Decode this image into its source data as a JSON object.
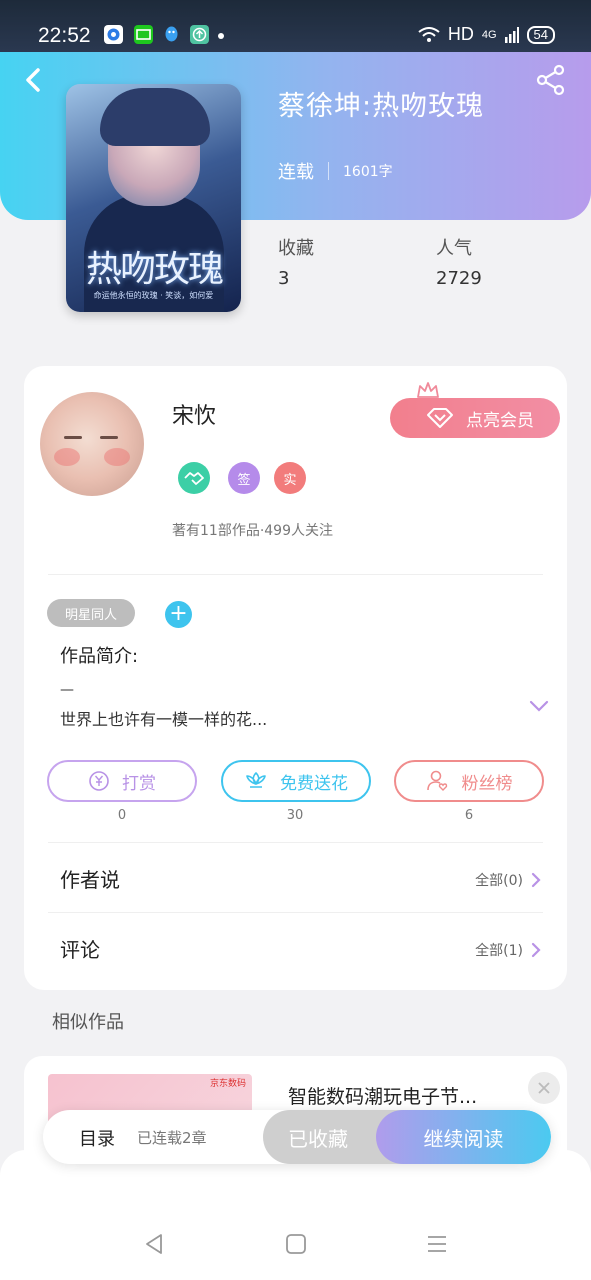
{
  "status_bar": {
    "time": "22:52",
    "network": "HD",
    "signal": "4G",
    "battery": "54"
  },
  "book": {
    "title": "蔡徐坤:热吻玫瑰",
    "status": "连载",
    "word_count": "1601字",
    "cover_title": "热吻玫瑰",
    "cover_subtitle": "命运他永恒的玫瑰 · 笑谈，如何爱",
    "stats": [
      {
        "label": "收藏",
        "value": "3"
      },
      {
        "label": "人气",
        "value": "2729"
      }
    ]
  },
  "author": {
    "name": "宋忺",
    "vip_button": "点亮会员",
    "badges": [
      {
        "label": "",
        "color": "#3ccfa6",
        "icon": "handshake-icon"
      },
      {
        "label": "签",
        "color": "#b58bea"
      },
      {
        "label": "实",
        "color": "#f27c7c"
      }
    ],
    "stats": "著有11部作品·499人关注"
  },
  "tags": {
    "pill": "明星同人",
    "add": "+"
  },
  "intro": {
    "title": "作品简介:",
    "dash": "—",
    "text": "世界上也许有一模一样的花..."
  },
  "actions": [
    {
      "label": "打赏",
      "count": "0",
      "color": "#b892e6",
      "icon": "yuan-icon"
    },
    {
      "label": "免费送花",
      "count": "30",
      "color": "#3ec4ee",
      "icon": "flower-icon"
    },
    {
      "label": "粉丝榜",
      "count": "6",
      "color": "#f08c8c",
      "icon": "fan-user-icon"
    }
  ],
  "sections": [
    {
      "title": "作者说",
      "more": "全部(0)"
    },
    {
      "title": "评论",
      "more": "全部(1)"
    }
  ],
  "similar": {
    "title": "相似作品",
    "items": [
      {
        "name": "智能数码潮玩电子节...",
        "thumb_label": "京东数码"
      }
    ]
  },
  "bottom_bar": {
    "toc_label": "目录",
    "toc_count": "已连载2章",
    "collected": "已收藏",
    "continue": "继续阅读"
  }
}
